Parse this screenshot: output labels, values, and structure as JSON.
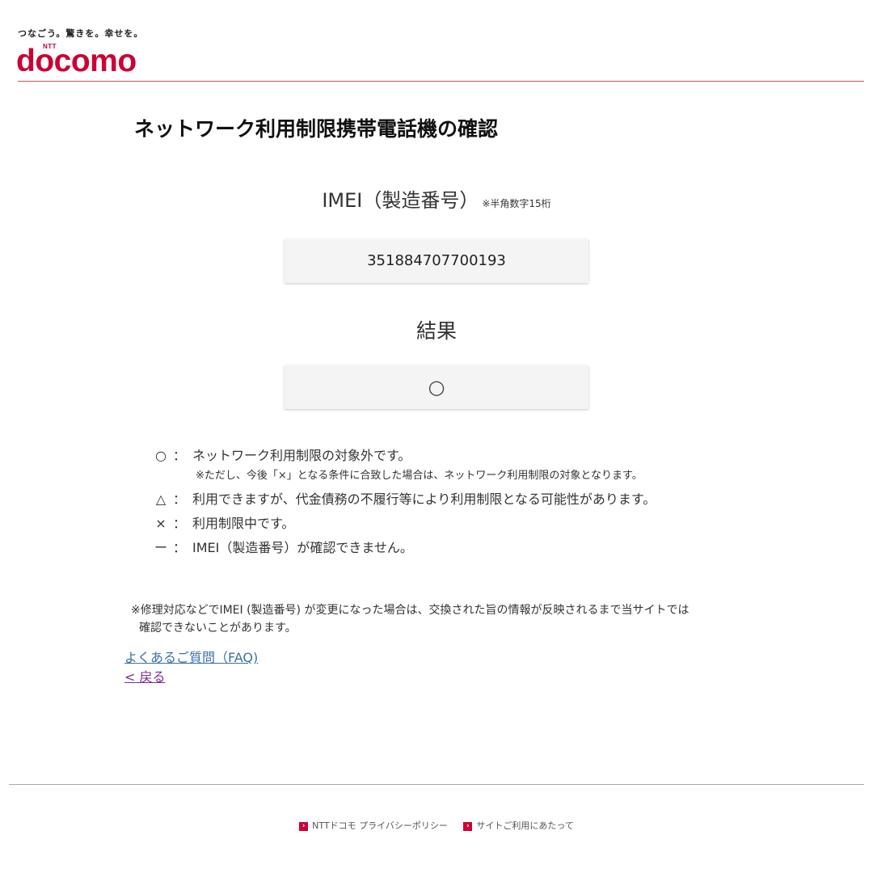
{
  "header": {
    "tagline": "つなごう。驚きを。幸せを。",
    "logo_small": "NTT",
    "logo_text": "docomo"
  },
  "page": {
    "title": "ネットワーク利用制限携帯電話機の確認"
  },
  "imei": {
    "label": "IMEI（製造番号）",
    "note": "※半角数字15桁",
    "value": "351884707700193"
  },
  "result": {
    "label": "結果",
    "value": "○"
  },
  "legend": {
    "items": [
      {
        "symbol": "○",
        "colon": "：",
        "description": "ネットワーク利用制限の対象外です。"
      },
      {
        "symbol": "△",
        "colon": "：",
        "description": "利用できますが、代金債務の不履行等により利用制限となる可能性があります。"
      },
      {
        "symbol": "×",
        "colon": "：",
        "description": "利用制限中です。"
      },
      {
        "symbol": "ー",
        "colon": "：",
        "description": "IMEI（製造番号）が確認できません。"
      }
    ],
    "sub_note": "※ただし、今後「×」となる条件に合致した場合は、ネットワーク利用制限の対象となります。"
  },
  "notice": {
    "line1": "※修理対応などでIMEI (製造番号) が変更になった場合は、交換された旨の情報が反映されるまで当サイトでは",
    "line2": "確認できないことがあります。"
  },
  "links": {
    "faq": "よくあるご質問（FAQ)",
    "back": "< 戻る"
  },
  "footer": {
    "privacy": "NTTドコモ プライバシーポリシー",
    "terms": "サイトご利用にあたって"
  },
  "colors": {
    "brand": "#cc0033",
    "link": "#3b6fa6",
    "visited_link": "#7a2a9a"
  }
}
